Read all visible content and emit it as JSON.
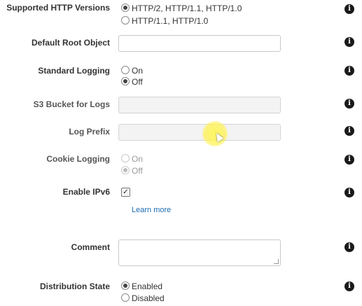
{
  "http_versions": {
    "label": "Supported HTTP Versions",
    "options": [
      "HTTP/2, HTTP/1.1, HTTP/1.0",
      "HTTP/1.1, HTTP/1.0"
    ],
    "selected": "HTTP/2, HTTP/1.1, HTTP/1.0"
  },
  "default_root_object": {
    "label": "Default Root Object",
    "value": ""
  },
  "standard_logging": {
    "label": "Standard Logging",
    "options": [
      "On",
      "Off"
    ],
    "selected": "Off"
  },
  "s3_bucket": {
    "label": "S3 Bucket for Logs",
    "value": ""
  },
  "log_prefix": {
    "label": "Log Prefix",
    "value": ""
  },
  "cookie_logging": {
    "label": "Cookie Logging",
    "options": [
      "On",
      "Off"
    ],
    "selected": "Off",
    "disabled": true
  },
  "ipv6": {
    "label": "Enable IPv6",
    "checked": true,
    "learn_more": "Learn more"
  },
  "comment": {
    "label": "Comment",
    "value": ""
  },
  "distribution_state": {
    "label": "Distribution State",
    "options": [
      "Enabled",
      "Disabled"
    ],
    "selected": "Enabled"
  },
  "info_icon_glyph": "i",
  "colors": {
    "link": "#1a6bb0",
    "cursor_highlight": "#fff25a"
  }
}
